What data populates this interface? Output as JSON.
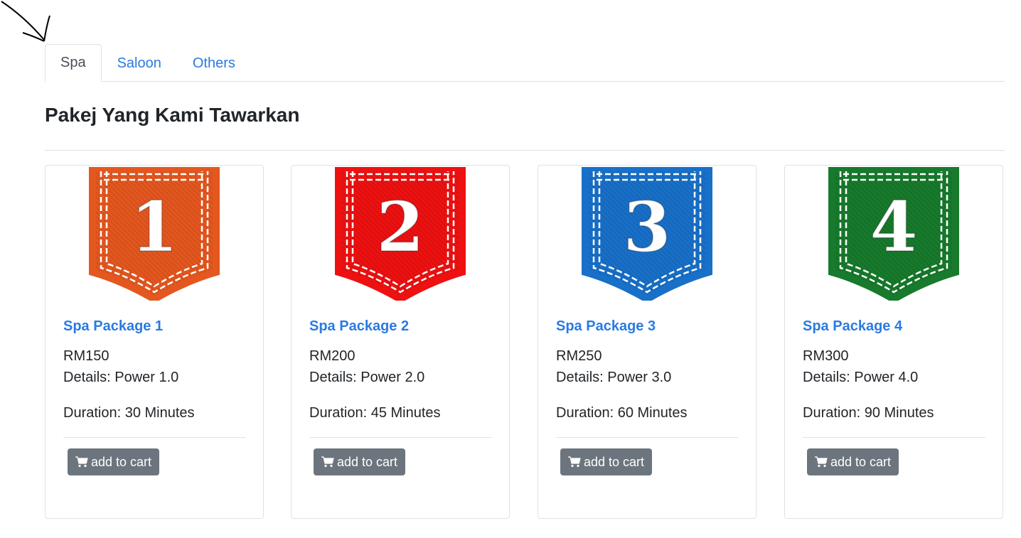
{
  "tabs": [
    {
      "label": "Spa",
      "active": true
    },
    {
      "label": "Saloon",
      "active": false
    },
    {
      "label": "Others",
      "active": false
    }
  ],
  "heading": "Pakej Yang Kami Tawarkan",
  "packages": [
    {
      "number": "1",
      "color": "#e4571f",
      "title": "Spa Package 1",
      "price": "RM150",
      "details": "Details: Power 1.0",
      "duration": "Duration: 30 Minutes",
      "button": "add to cart"
    },
    {
      "number": "2",
      "color": "#ee1111",
      "title": "Spa Package 2",
      "price": "RM200",
      "details": "Details: Power 2.0",
      "duration": "Duration: 45 Minutes",
      "button": "add to cart"
    },
    {
      "number": "3",
      "color": "#1870c8",
      "title": "Spa Package 3",
      "price": "RM250",
      "details": "Details: Power 3.0",
      "duration": "Duration: 60 Minutes",
      "button": "add to cart"
    },
    {
      "number": "4",
      "color": "#177a2c",
      "title": "Spa Package 4",
      "price": "RM300",
      "details": "Details: Power 4.0",
      "duration": "Duration: 90 Minutes",
      "button": "add to cart"
    }
  ],
  "colors": {
    "link": "#2a7ae2",
    "button": "#6c757d",
    "border": "#dee2e6"
  },
  "icons": {
    "arrow": "hand-drawn-arrow-icon",
    "cart": "shopping-cart-icon"
  }
}
